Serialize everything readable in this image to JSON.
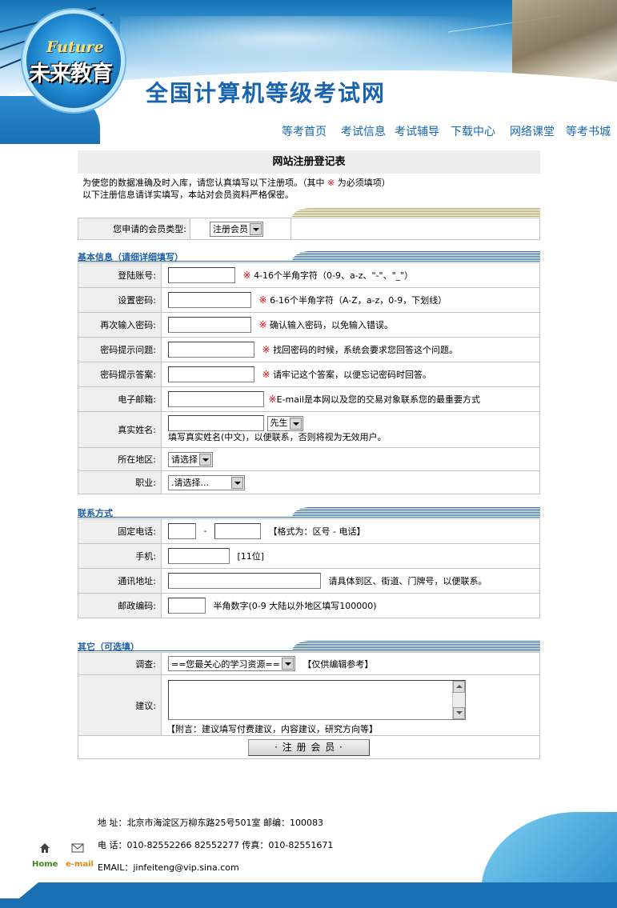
{
  "header": {
    "logo_en": "Future",
    "logo_cn": "未来教育",
    "site_title": "全国计算机等级考试网"
  },
  "nav": [
    "等考首页",
    "考试信息",
    "考试辅导",
    "下载中心",
    "网络课堂",
    "等考书城"
  ],
  "form": {
    "title": "网站注册登记表",
    "intro_1a": "为使您的数据准确及时入库，请您认真填写以下注册项。（其中",
    "intro_star": "※",
    "intro_1b": "为必须填项）",
    "intro_2": "以下注册信息请详实填写，本站对会员资料严格保密。",
    "member_type_label": "您申请的会员类型:",
    "member_type_value": "注册会员"
  },
  "sections": {
    "basic": "基本信息（请细详细填写）",
    "contact": "联系方式",
    "other": "其它（可选填）"
  },
  "required_mark": "※",
  "basic_fields": {
    "login": {
      "label": "登陆账号:",
      "hint": "4-16个半角字符（0-9、a-z、\"-\"、\"_\"）"
    },
    "password": {
      "label": "设置密码:",
      "hint": "6-16个半角字符（A-Z，a-z，0-9，下划线）"
    },
    "confirm": {
      "label": "再次输入密码:",
      "hint": "确认输入密码，以免输入错误。"
    },
    "question": {
      "label": "密码提示问题:",
      "hint": "找回密码的时候，系统会要求您回答这个问题。"
    },
    "answer": {
      "label": "密码提示答案:",
      "hint": "请牢记这个答案，以便忘记密码时回答。"
    },
    "email": {
      "label": "电子邮箱:",
      "hint": "E-mail是本网以及您的交易对象联系您的最重要方式"
    },
    "realname": {
      "label": "真实姓名:",
      "title_value": "先生",
      "hint": "填写真实姓名(中文)，以便联系，否则将视为无效用户。"
    },
    "region": {
      "label": "所在地区:",
      "value": "请选择"
    },
    "job": {
      "label": "职业:",
      "value": ".请选择..."
    }
  },
  "contact_fields": {
    "phone": {
      "label": "固定电话:",
      "dash": "-",
      "hint": "【格式为：区号 - 电话】"
    },
    "mobile": {
      "label": "手机:",
      "hint": "[11位]"
    },
    "address": {
      "label": "通讯地址:",
      "hint": "请具体到区、街道、门牌号，以便联系。"
    },
    "zip": {
      "label": "邮政编码:",
      "hint": "半角数字(0-9 大陆以外地区填写100000)"
    }
  },
  "other_fields": {
    "survey": {
      "label": "调查:",
      "value": "==您最关心的学习资源==",
      "hint": "【仅供编辑参考】"
    },
    "suggest": {
      "label": "建议:",
      "hint": "【附言：建议填写付费建议，内容建议，研究方向等】"
    }
  },
  "submit_label": "· 注 册 会 员 ·",
  "footer": {
    "address": "地  址：北京市海淀区万柳东路25号501室   邮编：100083",
    "phone": "电  话：010-82552266 82552277  传真：010-82551671",
    "email": "EMAIL：jinfeiteng@vip.sina.com",
    "home_label": "Home",
    "email_label": "e-mail"
  },
  "colors": {
    "nav_text": "#1466b4",
    "section_blue": "#2f6fba",
    "section_gold": "#c9a25a",
    "required_red": "#e60000",
    "label_bg": "#efefef"
  },
  "icons": [
    "home-icon",
    "mail-icon",
    "dropdown-arrow-icon",
    "scroll-up-icon",
    "scroll-down-icon"
  ]
}
